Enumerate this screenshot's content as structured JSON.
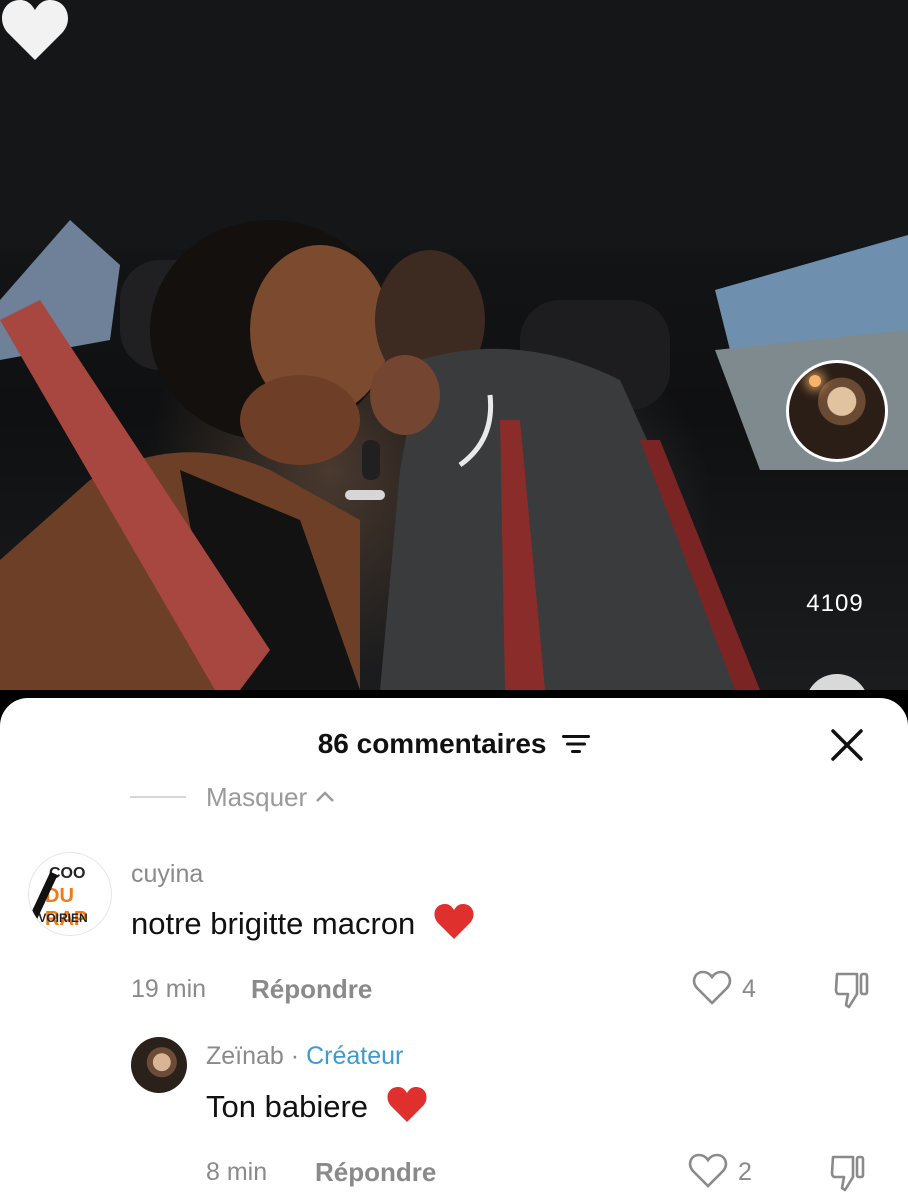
{
  "video": {
    "like_count": "4109",
    "profile_avatar_icon": "profile-avatar",
    "like_icon": "heart-icon"
  },
  "comments_sheet": {
    "title": "86 commentaires",
    "sort_icon": "sort-icon",
    "close_icon": "close-icon",
    "hide_label": "Masquer",
    "comments": [
      {
        "username": "cuyina",
        "text": "notre brigitte macron",
        "emoji": "red-heart-emoji",
        "time": "19 min",
        "reply_label": "Répondre",
        "likes": "4"
      }
    ],
    "replies": [
      {
        "username": "Zeïnab",
        "separator": "·",
        "badge": "Créateur",
        "text": "Ton babiere",
        "emoji": "red-heart-emoji",
        "time": "8 min",
        "reply_label": "Répondre",
        "likes": "2"
      }
    ],
    "avatar_logo_text": [
      "COO",
      "DU RAP",
      "IVOIRIEN"
    ]
  },
  "colors": {
    "creator_badge": "#3d9ad1",
    "heart_red": "#e0302d",
    "muted_text": "#8a8a8a"
  }
}
